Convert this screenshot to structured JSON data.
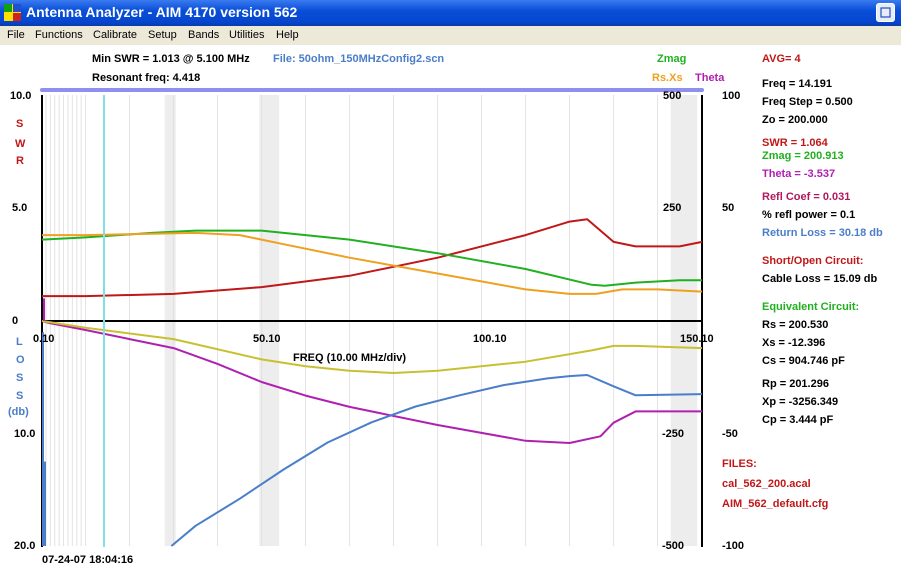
{
  "window": {
    "title": "Antenna Analyzer -   AIM 4170 version 562",
    "close_icon": "close-icon",
    "app_icon": "aim-app-icon"
  },
  "menu": [
    "File",
    "Functions",
    "Calibrate",
    "Setup",
    "Bands",
    "Utilities",
    "Help"
  ],
  "header": {
    "min_swr": "Min SWR =  1.013 @  5.100 MHz",
    "resonant": "Resonant freq:  4.418",
    "file": "File: 50ohm_150MHzConfig2.scn",
    "zmag": "Zmag",
    "rsxs": "Rs.Xs",
    "theta": "Theta"
  },
  "axes": {
    "swr_ticks": [
      "10.0",
      "5.0",
      "0"
    ],
    "swr_letters": [
      "S",
      "W",
      "R"
    ],
    "loss_ticks": [
      "10.0",
      "20.0"
    ],
    "loss_letters": [
      "L",
      "O",
      "S",
      "S"
    ],
    "loss_unit": "(db)",
    "zmag_ticks": [
      "500",
      "250",
      "-250",
      "-500"
    ],
    "theta_ticks": [
      "100",
      "50",
      "-50",
      "-100"
    ],
    "freq_ticks": [
      "0.10",
      "50.10",
      "100.10",
      "150.10"
    ],
    "freq_label": "FREQ (10.00 MHz/div)",
    "timestamp": "07-24-07   18:04:16"
  },
  "readout": {
    "avg": "AVG=  4",
    "freq": "Freq =  14.191",
    "freq_step": "Freq Step = 0.500",
    "zo": "Zo =  200.000",
    "swr": "SWR  =   1.064",
    "zmag": "Zmag =  200.913",
    "theta": "Theta =    -3.537",
    "refl_coef": "Refl Coef   = 0.031",
    "refl_power": "% refl power =  0.1",
    "return_loss": "Return Loss = 30.18  db",
    "short_open": "Short/Open Circuit:",
    "cable_loss": "Cable Loss = 15.09  db",
    "equiv": "Equivalent Circuit:",
    "rs": "Rs =  200.530",
    "xs": "Xs =  -12.396",
    "cs": "Cs =  904.746  pF",
    "rp": "Rp =  201.296",
    "xp": "Xp =  -3256.349",
    "cp": "Cp =     3.444  pF",
    "files_label": "FILES:",
    "file1": "cal_562_200.acal",
    "file2": "AIM_562_default.cfg"
  },
  "colors": {
    "swr": "#c01818",
    "zmag": "#20b020",
    "rsxs": "#f0a020",
    "theta": "#b020b0",
    "loss": "#4a7ec8",
    "olive": "#c8c030",
    "cursor": "#7fe0e8",
    "header_blue": "#4a7ec8"
  },
  "chart_data": {
    "type": "line",
    "xlim": [
      0.1,
      150.1
    ],
    "swr_ylim": [
      0,
      10
    ],
    "zmag_ylim": [
      -500,
      500
    ],
    "theta_ylim": [
      -100,
      100
    ],
    "loss_ylim": [
      0,
      20
    ],
    "cursor_freq": 14.191,
    "series": [
      {
        "key": "swr",
        "x": [
          0.1,
          10,
          30,
          50,
          70,
          90,
          110,
          120,
          124,
          130,
          135,
          145,
          150.1
        ],
        "y": [
          1.1,
          1.1,
          1.2,
          1.5,
          2.0,
          2.8,
          3.8,
          4.4,
          4.5,
          3.5,
          3.3,
          3.3,
          3.5
        ]
      },
      {
        "key": "zmag",
        "x": [
          0.1,
          10,
          25,
          35,
          50,
          70,
          90,
          110,
          125,
          128,
          135,
          145,
          150.1
        ],
        "y": [
          180,
          185,
          195,
          200,
          200,
          180,
          150,
          115,
          80,
          78,
          85,
          90,
          90
        ]
      },
      {
        "key": "rsxs",
        "x": [
          0.1,
          10,
          25,
          35,
          45,
          55,
          70,
          90,
          110,
          120,
          126,
          132,
          140,
          150.1
        ],
        "y": [
          190,
          190,
          193,
          195,
          190,
          170,
          140,
          105,
          70,
          60,
          60,
          70,
          70,
          65
        ]
      },
      {
        "key": "theta",
        "x": [
          0.1,
          2,
          10,
          20,
          30,
          40,
          50,
          60,
          70,
          90,
          110,
          120,
          127,
          130,
          135,
          145,
          150.1
        ],
        "y": [
          0,
          -1,
          -4,
          -8,
          -12,
          -19,
          -27,
          -33,
          -38,
          -46,
          -53,
          -54,
          -51,
          -45,
          -40,
          -40,
          -40
        ]
      },
      {
        "key": "olive",
        "x": [
          0.1,
          10,
          30,
          50,
          60,
          70,
          80,
          90,
          110,
          125,
          130,
          135,
          150.1
        ],
        "y": [
          0,
          -3,
          -8,
          -17,
          -20,
          -22,
          -23,
          -22,
          -18,
          -13,
          -11,
          -11,
          -12
        ]
      },
      {
        "key": "loss",
        "x": [
          29.5,
          35,
          45,
          55,
          65,
          75,
          85,
          95,
          105,
          115,
          120,
          124,
          130,
          135,
          150.1
        ],
        "y": [
          20.0,
          18.2,
          15.8,
          13.2,
          10.8,
          9.0,
          7.6,
          6.6,
          5.7,
          5.1,
          4.9,
          4.8,
          5.8,
          6.6,
          6.5
        ]
      }
    ]
  }
}
